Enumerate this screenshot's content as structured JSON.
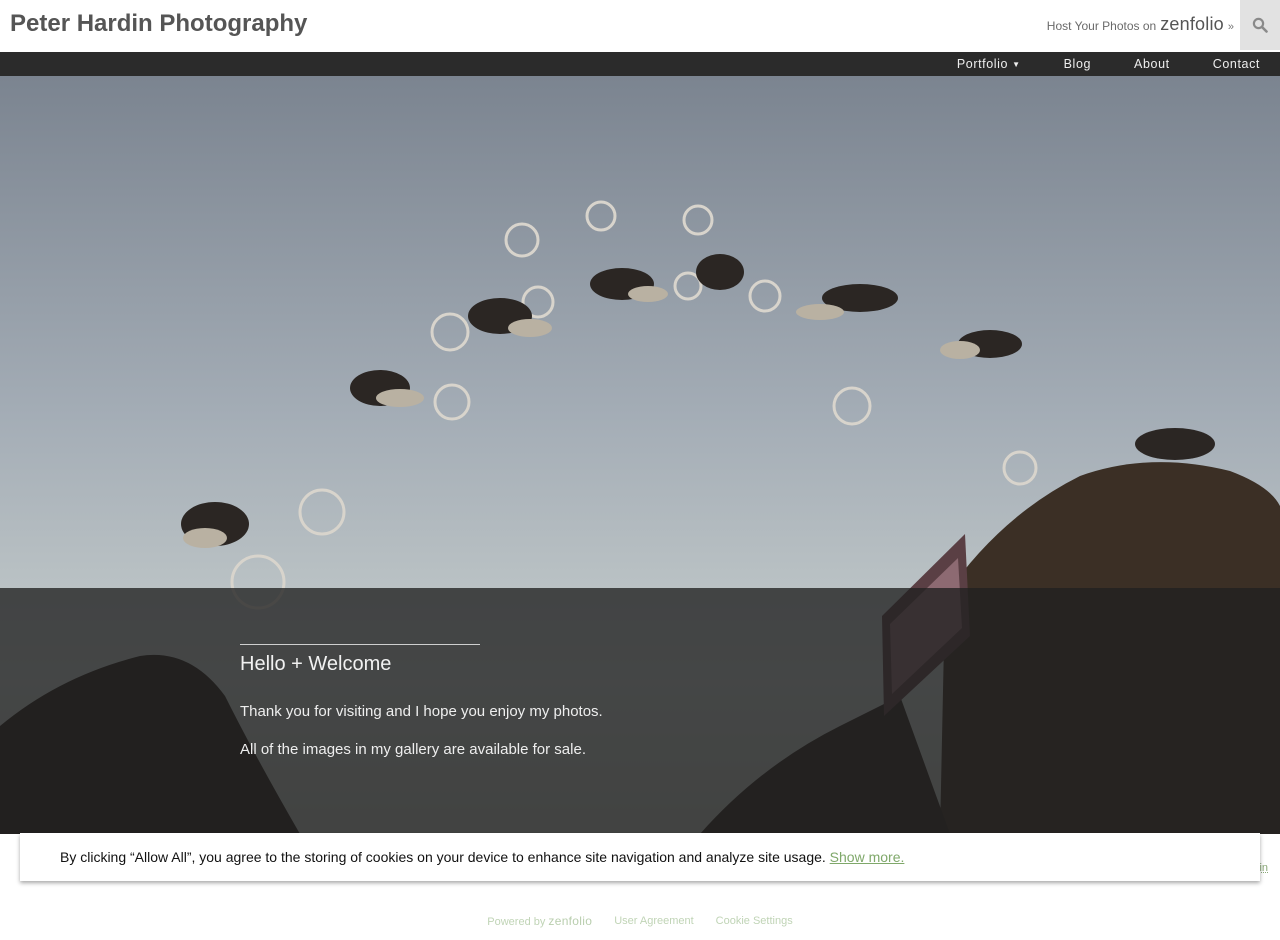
{
  "header": {
    "site_title": "Peter Hardin Photography",
    "host_text": "Host Your Photos on",
    "host_brand": "zenfolio",
    "host_arrow": "»"
  },
  "nav": {
    "items": [
      {
        "label": "Portfolio",
        "has_dropdown": true
      },
      {
        "label": "Blog"
      },
      {
        "label": "About"
      },
      {
        "label": "Contact"
      }
    ],
    "caret": "▼"
  },
  "hero": {
    "image_description": "",
    "heading": "Hello + Welcome",
    "paragraphs": [
      "Thank you for visiting and I hope you enjoy my photos.",
      "All of the images in my gallery are available for sale."
    ]
  },
  "cookie_banner": {
    "text": "By clicking “Allow All”, you agree to the storing of cookies on your device to enhance site navigation and analyze site usage.",
    "link": "Show more."
  },
  "footer": {
    "powered_by": "Powered by",
    "brand": "zenfolio",
    "user_agreement": "User Agreement",
    "cookie_settings": "Cookie Settings",
    "login_peek": "in"
  },
  "colors": {
    "nav_bg": "#2b2b2b",
    "overlay": "rgba(32,32,32,0.78)",
    "link_green": "#7fa86a",
    "sky_top": "#77808e",
    "sky_bottom": "#c8cfcf"
  }
}
